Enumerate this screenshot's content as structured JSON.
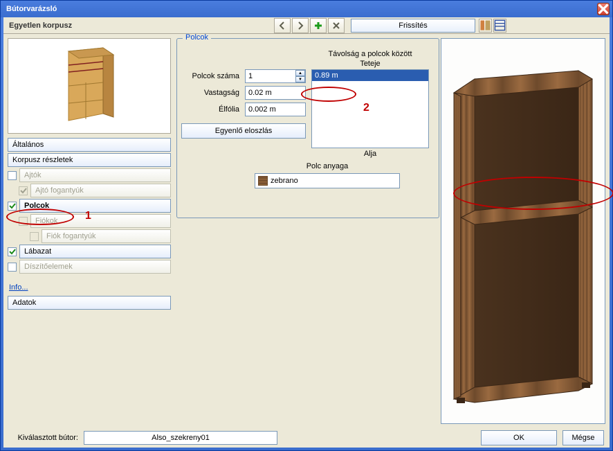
{
  "window": {
    "title": "Bútorvarázsló"
  },
  "toolbar": {
    "subtitle": "Egyetlen korpusz",
    "refresh_label": "Frissítés"
  },
  "sidebar": {
    "general": "Általános",
    "details": "Korpusz részletek",
    "doors": "Ajtók",
    "door_handles": "Ajtó fogantyúk",
    "shelves": "Polcok",
    "drawers": "Fiókok",
    "drawer_handles": "Fiók fogantyúk",
    "legs": "Lábazat",
    "ornaments": "Díszítőelemek",
    "info": "Info...",
    "data": "Adatok"
  },
  "shelves_panel": {
    "legend": "Polcok",
    "count_label": "Polcok száma",
    "count_value": "1",
    "thickness_label": "Vastagság",
    "thickness_value": "0.02 m",
    "edgefoil_label": "Élfólia",
    "edgefoil_value": "0.002 m",
    "equal_label": "Egyenlő eloszlás",
    "dist_header": "Távolság a polcok között",
    "dist_top": "Teteje",
    "dist_bottom": "Alja",
    "dist_items": [
      "0.89 m"
    ],
    "material_label": "Polc anyaga",
    "material_value": "zebrano"
  },
  "footer": {
    "selected_label": "Kiválasztott bútor:",
    "selected_value": "Also_szekreny01",
    "ok": "OK",
    "cancel": "Mégse"
  },
  "annotations": {
    "one": "1",
    "two": "2"
  },
  "colors": {
    "accent": "#c00000",
    "wood": "#7a4e2e"
  }
}
